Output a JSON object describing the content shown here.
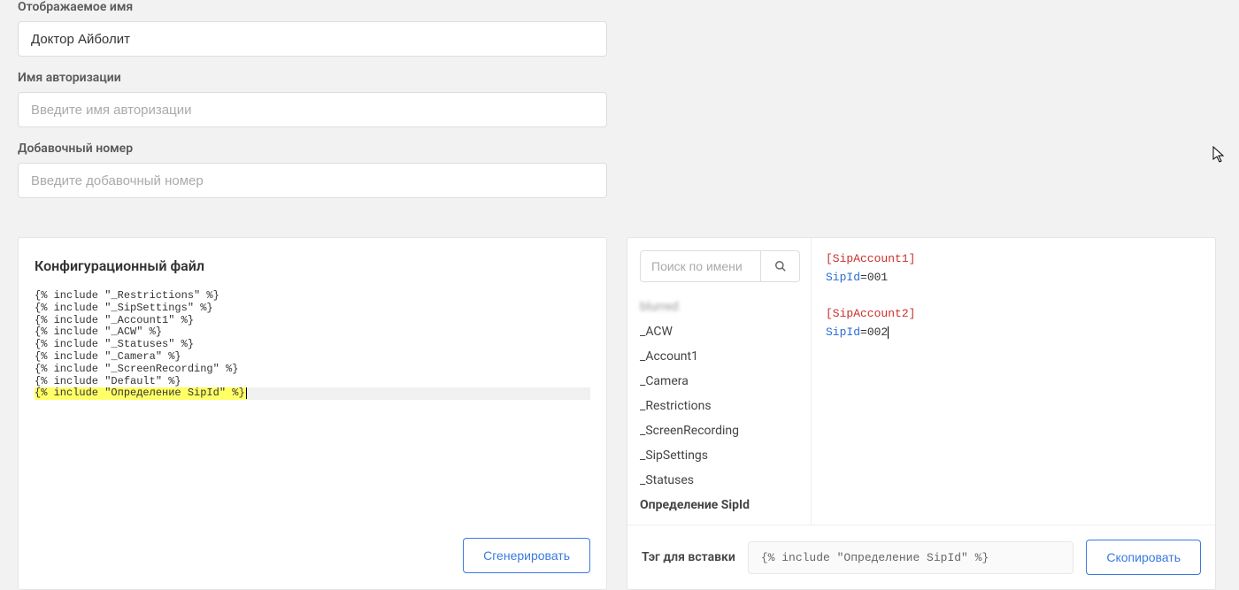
{
  "fields": {
    "display_name": {
      "label": "Отображаемое имя",
      "value": "Доктор Айболит"
    },
    "auth_name": {
      "label": "Имя авторизации",
      "placeholder": "Введите имя авторизации",
      "value": ""
    },
    "extension": {
      "label": "Добавочный номер",
      "placeholder": "Введите добавочный номер",
      "value": ""
    }
  },
  "config": {
    "title": "Конфигурационный файл",
    "lines": [
      "{% include \"_Restrictions\" %}",
      "{% include \"_SipSettings\" %}",
      "{% include \"_Account1\" %}",
      "{% include \"_ACW\" %}",
      "{% include \"_Statuses\" %}",
      "{% include \"_Camera\" %}",
      "{% include \"_ScreenRecording\" %}",
      "{% include \"Default\" %}"
    ],
    "highlighted_line": "{% include \"Определение SipId\" %}",
    "generate_btn": "Сгенерировать"
  },
  "template_list": {
    "search_placeholder": "Поиск по имени",
    "items": [
      {
        "label": "blurred",
        "blurred": true
      },
      {
        "label": "_ACW"
      },
      {
        "label": "_Account1"
      },
      {
        "label": "_Camera"
      },
      {
        "label": "_Restrictions"
      },
      {
        "label": "_ScreenRecording"
      },
      {
        "label": "_SipSettings"
      },
      {
        "label": "_Statuses"
      },
      {
        "label": "Определение SipId",
        "selected": true
      }
    ]
  },
  "preview": {
    "blocks": [
      {
        "section": "[SipAccount1]",
        "key": "SipId",
        "eq": "=",
        "val": "001"
      },
      {
        "section": "[SipAccount2]",
        "key": "SipId",
        "eq": "=",
        "val": "002"
      }
    ]
  },
  "tag": {
    "label": "Тэг для вставки",
    "value": "{% include \"Определение SipId\" %}",
    "copy_btn": "Скопировать"
  }
}
